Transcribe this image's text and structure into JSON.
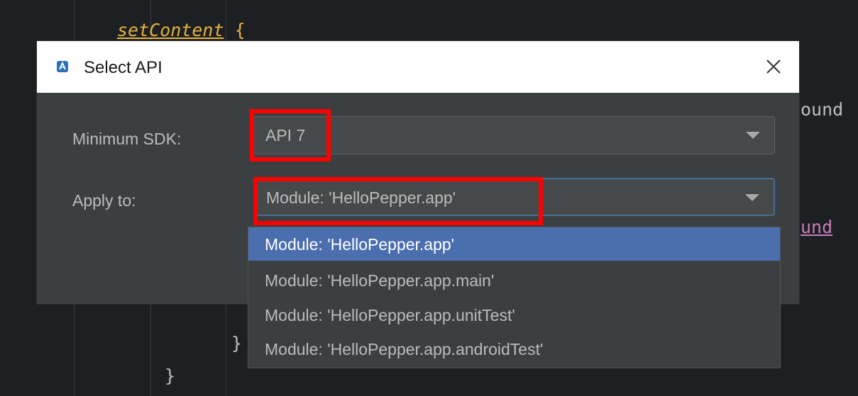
{
  "editor": {
    "line_set_content": "setContent",
    "line_set_content_brace": "{",
    "fragment_ound_1": "ound",
    "fragment_und_2": "und",
    "closing_brace_1": "}",
    "closing_brace_2": "}"
  },
  "dialog": {
    "title": "Select API",
    "min_sdk": {
      "label": "Minimum SDK:",
      "value": "API 7"
    },
    "apply_to": {
      "label": "Apply to:",
      "value": "Module: 'HelloPepper.app'"
    },
    "dropdown_options": [
      "Module: 'HelloPepper.app'",
      "Module: 'HelloPepper.app.main'",
      "Module: 'HelloPepper.app.unitTest'",
      "Module: 'HelloPepper.app.androidTest'"
    ],
    "selected_option_index": 0
  },
  "colors": {
    "highlight_box": "#ff0000",
    "selected_item": "#4b6eaf",
    "dialog_bg": "#3c3f41",
    "editor_bg": "#1e1f22"
  }
}
